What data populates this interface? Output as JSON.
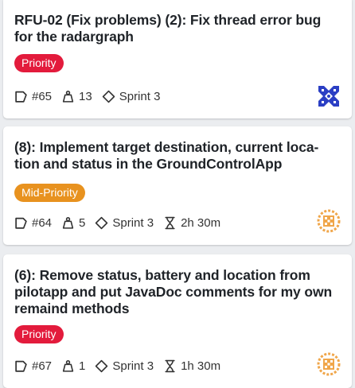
{
  "colors": {
    "priority": "#e31b3c",
    "mid_priority": "#e8921f",
    "avatar_blue": "#2b3fc4",
    "avatar_orange": "#f0a64a"
  },
  "cards": [
    {
      "title": "RFU-02 (Fix problems) (2): Fix thread error bug for the radargraph",
      "badge": "Priority",
      "issue": "#65",
      "weight": "13",
      "sprint": "Sprint 3",
      "time": "",
      "avatar_icon": "identicon-blue-icon"
    },
    {
      "title": "(8): Implement target destination, current loca-tion and status in the GroundControlApp",
      "badge": "Mid-Priority",
      "issue": "#64",
      "weight": "5",
      "sprint": "Sprint 3",
      "time": "2h 30m",
      "avatar_icon": "identicon-orange-icon"
    },
    {
      "title": "(6): Remove status, battery and location from pilotapp and put JavaDoc comments for my own remaind methods",
      "badge": "Priority",
      "issue": "#67",
      "weight": "1",
      "sprint": "Sprint 3",
      "time": "1h 30m",
      "avatar_icon": "identicon-orange-icon"
    }
  ]
}
